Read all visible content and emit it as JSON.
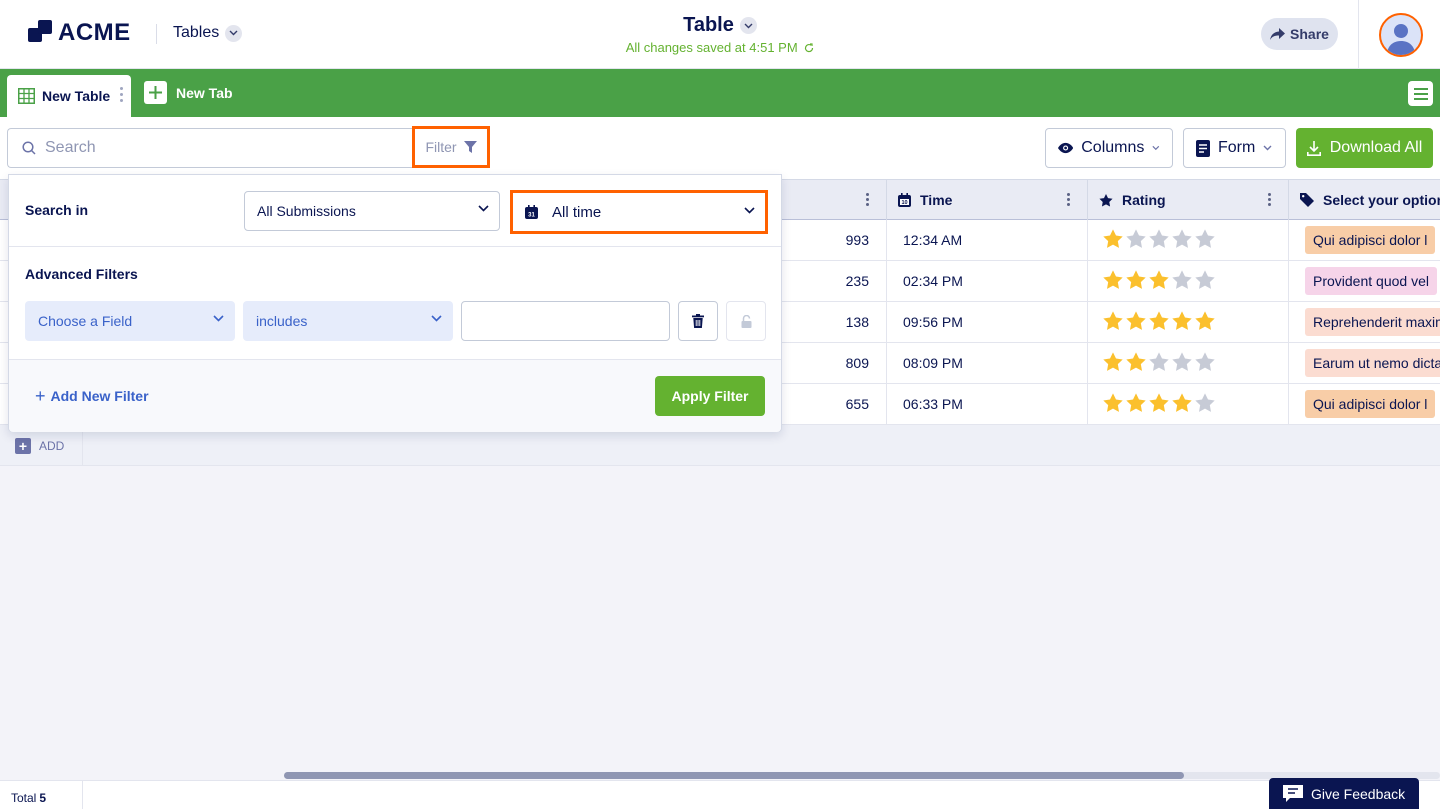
{
  "header": {
    "logo_text": "ACME",
    "tables_menu": "Tables",
    "title": "Table",
    "saved_status": "All changes saved at 4:51 PM",
    "share_label": "Share"
  },
  "tabs": {
    "active_label": "New Table",
    "new_tab_label": "New Tab"
  },
  "toolbar": {
    "search_placeholder": "Search",
    "filter_label": "Filter",
    "columns_label": "Columns",
    "form_label": "Form",
    "download_label": "Download All"
  },
  "filter_panel": {
    "search_in_label": "Search in",
    "submissions_value": "All Submissions",
    "date_value": "All time",
    "date_icon_text": "31",
    "advanced_label": "Advanced Filters",
    "field_placeholder": "Choose a Field",
    "operator_value": "includes",
    "value_input": "",
    "add_filter_label": "Add New Filter",
    "apply_label": "Apply Filter"
  },
  "table": {
    "columns": [
      {
        "label": "Time",
        "icon": "calendar-icon"
      },
      {
        "label": "Rating",
        "icon": "star-icon"
      },
      {
        "label": "Select your option",
        "icon": "tag-icon"
      }
    ],
    "rows": [
      {
        "number": "993",
        "time": "12:34 AM",
        "rating": 1,
        "option": "Qui adipisci dolor l",
        "option_color": "#f8cda7"
      },
      {
        "number": "235",
        "time": "02:34 PM",
        "rating": 3,
        "option": "Provident quod vel",
        "option_color": "#f6d4e9"
      },
      {
        "number": "138",
        "time": "09:56 PM",
        "rating": 5,
        "option": "Reprehenderit maxim",
        "option_color": "#fbdcd1"
      },
      {
        "number": "809",
        "time": "08:09 PM",
        "rating": 2,
        "option": "Earum ut nemo dicta",
        "option_color": "#fbdcd1"
      },
      {
        "number": "655",
        "time": "06:33 PM",
        "rating": 4,
        "option": "Qui adipisci dolor l",
        "option_color": "#f8cda7"
      }
    ],
    "add_label": "ADD"
  },
  "footer": {
    "total_label": "Total",
    "total_value": "5",
    "feedback_label": "Give Feedback"
  },
  "colors": {
    "brand_green": "#4aa147",
    "highlight_orange": "#ff6100",
    "star_filled": "#fbc02d",
    "star_empty": "#c7cbd6"
  }
}
